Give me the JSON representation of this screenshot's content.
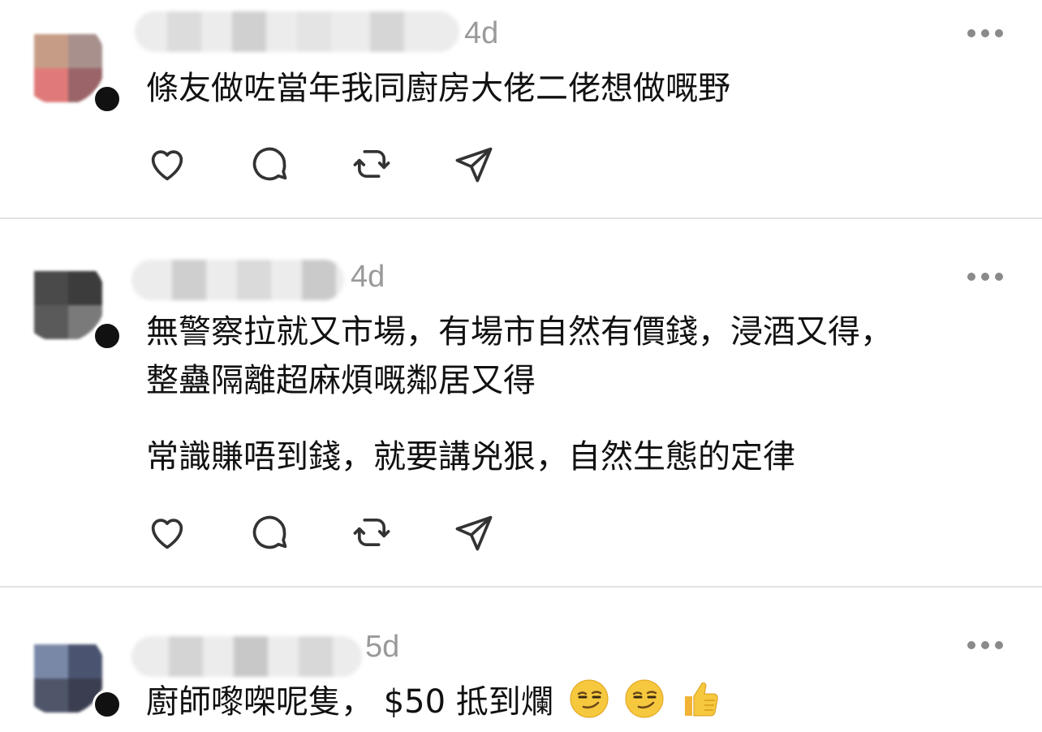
{
  "posts": [
    {
      "time": "4d",
      "paragraphs": [
        "條友做咗當年我同廚房大佬二佬想做嘅野"
      ],
      "avatar_colors": [
        "#c79c86",
        "#a8908d",
        "#e07a7a",
        "#9a6468"
      ]
    },
    {
      "time": "4d",
      "paragraphs": [
        "無警察拉就又市場，有場市自然有價錢，浸酒又得，",
        "整蠱隔離超麻煩嘅鄰居又得",
        "常識賺唔到錢，就要講兇狠，自然生態的定律"
      ],
      "avatar_colors": [
        "#4a4a4a",
        "#3c3c3c",
        "#5a5a5a",
        "#7a7a7a"
      ]
    },
    {
      "time": "5d",
      "paragraphs": [
        "廚師嚟㗎呢隻， $50 抵到爛"
      ],
      "emojis": [
        "smirking-face",
        "smirking-face",
        "thumbs-up"
      ],
      "avatar_colors": [
        "#7a88a8",
        "#4a5470",
        "#50566a",
        "#3a3e50"
      ]
    }
  ],
  "icons": {
    "like": "heart-icon",
    "reply": "comment-icon",
    "repost": "repost-icon",
    "share": "send-icon",
    "more": "more-icon"
  },
  "colors": {
    "text": "#111111",
    "meta": "#9a9a9a",
    "divider": "#e2e2e2"
  }
}
